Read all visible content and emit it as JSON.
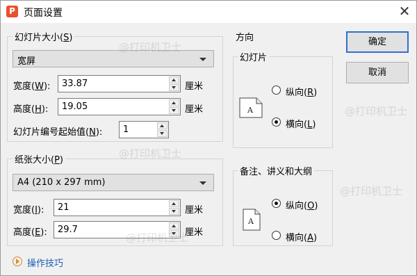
{
  "window": {
    "title": "页面设置",
    "app_icon_letter": "P",
    "close_glyph": "✕"
  },
  "slide_size": {
    "group_label": "幻灯片大小(",
    "group_key": "S",
    "group_tail": ")",
    "preset": "宽屏",
    "width_label": "宽度(",
    "width_key": "W",
    "width_tail": "):",
    "width_value": "33.87",
    "width_unit": "厘米",
    "height_label": "高度(",
    "height_key": "H",
    "height_tail": "):",
    "height_value": "19.05",
    "height_unit": "厘米",
    "number_label": "幻灯片编号起始值(",
    "number_key": "N",
    "number_tail": "):",
    "number_value": "1"
  },
  "paper_size": {
    "group_label": "纸张大小(",
    "group_key": "P",
    "group_tail": ")",
    "preset": "A4 (210 x 297 mm)",
    "width_label": "宽度(",
    "width_key": "I",
    "width_tail": "):",
    "width_value": "21",
    "width_unit": "厘米",
    "height_label": "高度(",
    "height_key": "E",
    "height_tail": "):",
    "height_value": "29.7",
    "height_unit": "厘米"
  },
  "orientation": {
    "group_label": "方向",
    "slides": {
      "label": "幻灯片",
      "portrait_label": "纵向(",
      "portrait_key": "R",
      "portrait_tail": ")",
      "landscape_label": "横向(",
      "landscape_key": "L",
      "landscape_tail": ")",
      "selected": "landscape"
    },
    "notes": {
      "label": "备注、讲义和大纲",
      "portrait_label": "纵向(",
      "portrait_key": "O",
      "portrait_tail": ")",
      "landscape_label": "横向(",
      "landscape_key": "A",
      "landscape_tail": ")",
      "selected": "portrait"
    },
    "page_glyph": "A"
  },
  "buttons": {
    "ok": "确定",
    "cancel": "取消"
  },
  "tips_link": "操作技巧",
  "watermark": "@打印机卫士",
  "colors": {
    "accent": "#2f6fce",
    "link": "#1a5fb4",
    "app_icon": "#e8512d"
  }
}
